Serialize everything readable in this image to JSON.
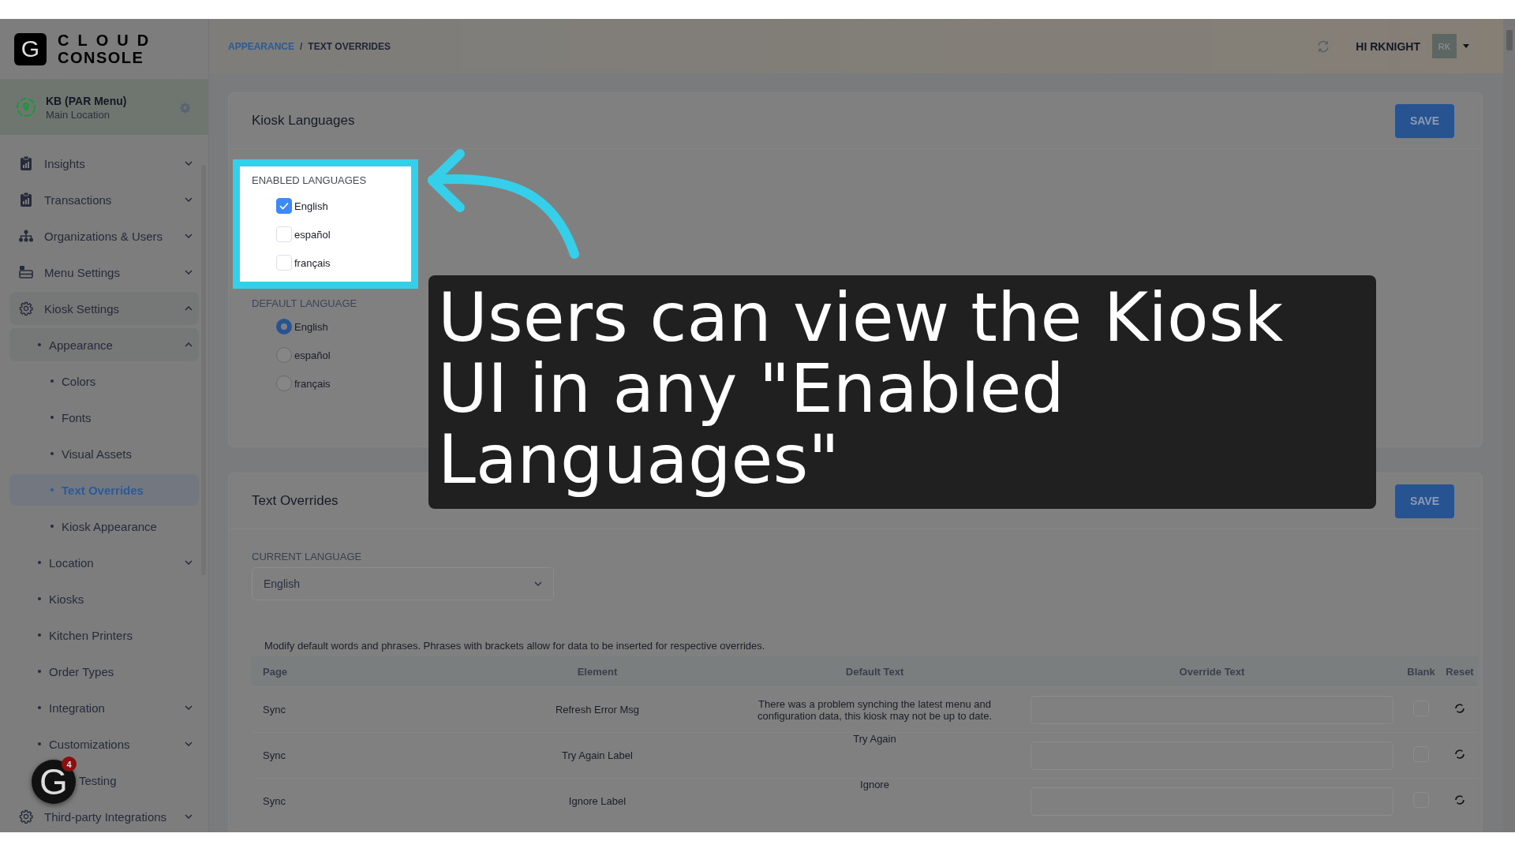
{
  "logo": {
    "mark": "G",
    "line_1": "CLOUD",
    "line_2": "CONSOLE"
  },
  "location": {
    "name": "KB (PAR Menu)",
    "subtitle": "Main Location"
  },
  "sidebar": {
    "items": [
      {
        "label": "Insights",
        "kind": "clipboard-chart",
        "expanded": false,
        "selected": false
      },
      {
        "label": "Transactions",
        "kind": "clipboard-chart",
        "expanded": false,
        "selected": false
      },
      {
        "label": "Organizations & Users",
        "kind": "sitemap",
        "expanded": false,
        "selected": false
      },
      {
        "label": "Menu Settings",
        "kind": "menu-card",
        "expanded": false,
        "selected": false
      },
      {
        "label": "Kiosk Settings",
        "kind": "gear",
        "expanded": true,
        "selected": false,
        "children": [
          {
            "label": "Appearance",
            "expanded": true,
            "selected": false,
            "children": [
              {
                "label": "Colors",
                "selected": false
              },
              {
                "label": "Fonts",
                "selected": false
              },
              {
                "label": "Visual Assets",
                "selected": false
              },
              {
                "label": "Text Overrides",
                "selected": true
              },
              {
                "label": "Kiosk Appearance",
                "selected": false
              }
            ]
          },
          {
            "label": "Location",
            "expanded": false,
            "selected": false
          },
          {
            "label": "Kiosks",
            "selected": false
          },
          {
            "label": "Kitchen Printers",
            "selected": false
          },
          {
            "label": "Order Types",
            "selected": false
          },
          {
            "label": "Integration",
            "expanded": false,
            "selected": false
          },
          {
            "label": "Customizations",
            "expanded": false,
            "selected": false
          },
          {
            "label": "Testing",
            "selected": false,
            "behind_launcher": true
          }
        ]
      },
      {
        "label": "Third-party Integrations",
        "kind": "gear",
        "expanded": false,
        "selected": false
      }
    ]
  },
  "breadcrumb": {
    "separator": "/",
    "items": [
      {
        "label": "APPEARANCE",
        "kind": "link"
      },
      {
        "label": "TEXT OVERRIDES",
        "kind": "current"
      }
    ]
  },
  "user": {
    "greeting": "HI RKNIGHT",
    "initials": "RK"
  },
  "kiosk_languages": {
    "title": "Kiosk Languages",
    "save_label": "SAVE",
    "enabled_languages": {
      "heading": "ENABLED LANGUAGES",
      "highlighted": true,
      "options": [
        {
          "label": "English",
          "checked": true
        },
        {
          "label": "español",
          "checked": false
        },
        {
          "label": "français",
          "checked": false
        }
      ]
    },
    "default_language": {
      "heading": "DEFAULT LANGUAGE",
      "options": [
        {
          "label": "English",
          "selected": true
        },
        {
          "label": "español",
          "selected": false
        },
        {
          "label": "français",
          "selected": false
        }
      ]
    }
  },
  "text_overrides": {
    "title": "Text Overrides",
    "save_label": "SAVE",
    "current_language_label": "CURRENT LANGUAGE",
    "current_language": "English",
    "description": "Modify default words and phrases. Phrases with brackets allow for data to be inserted for respective overrides.",
    "columns": [
      "Page",
      "Element",
      "Default Text",
      "Override Text",
      "Blank",
      "Reset"
    ],
    "rows": [
      {
        "page": "Sync",
        "element": "Refresh Error Msg",
        "default_text": "There was a problem synching the latest menu and configuration data, this kiosk may not be up to date.",
        "blank": false
      },
      {
        "page": "Sync",
        "element": "Try Again Label",
        "default_text": "Try Again",
        "blank": false
      },
      {
        "page": "Sync",
        "element": "Ignore Label",
        "default_text": "Ignore",
        "blank": false
      }
    ]
  },
  "tutorial": {
    "caption": "Users can view the Kiosk UI in any \"Enabled Languages\"",
    "launcher_mark": "G",
    "launcher_badge": "4"
  }
}
